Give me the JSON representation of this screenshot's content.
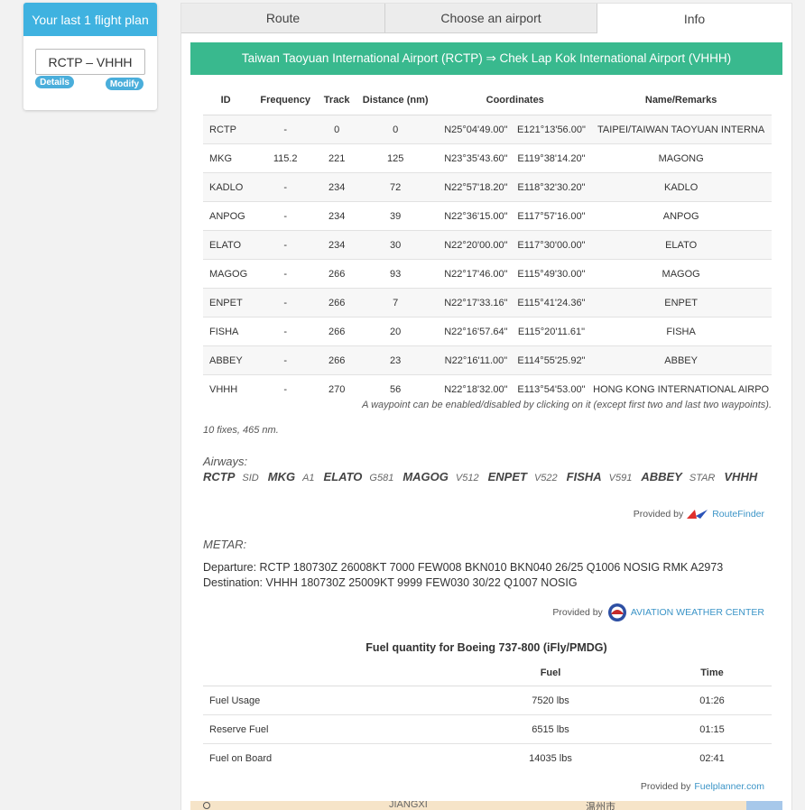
{
  "sidebar": {
    "header": "Your last 1 flight plan",
    "plan": "RCTP – VHHH",
    "details_label": "Details",
    "modify_label": "Modify"
  },
  "tabs": [
    "Route",
    "Choose an airport",
    "Info"
  ],
  "banner": "Taiwan Taoyuan International Airport (RCTP) ⇒ Chek Lap Kok International Airport (VHHH)",
  "waypoints": {
    "headers": [
      "ID",
      "Frequency",
      "Track",
      "Distance (nm)",
      "Coordinates",
      "Name/Remarks"
    ],
    "rows": [
      {
        "id": "RCTP",
        "freq": "-",
        "track": "0",
        "dist": "0",
        "lat": "N25°04'49.00\"",
        "lon": "E121°13'56.00\"",
        "name": "TAIPEI/TAIWAN TAOYUAN INTERNA"
      },
      {
        "id": "MKG",
        "freq": "115.2",
        "track": "221",
        "dist": "125",
        "lat": "N23°35'43.60\"",
        "lon": "E119°38'14.20\"",
        "name": "MAGONG"
      },
      {
        "id": "KADLO",
        "freq": "-",
        "track": "234",
        "dist": "72",
        "lat": "N22°57'18.20\"",
        "lon": "E118°32'30.20\"",
        "name": "KADLO"
      },
      {
        "id": "ANPOG",
        "freq": "-",
        "track": "234",
        "dist": "39",
        "lat": "N22°36'15.00\"",
        "lon": "E117°57'16.00\"",
        "name": "ANPOG"
      },
      {
        "id": "ELATO",
        "freq": "-",
        "track": "234",
        "dist": "30",
        "lat": "N22°20'00.00\"",
        "lon": "E117°30'00.00\"",
        "name": "ELATO"
      },
      {
        "id": "MAGOG",
        "freq": "-",
        "track": "266",
        "dist": "93",
        "lat": "N22°17'46.00\"",
        "lon": "E115°49'30.00\"",
        "name": "MAGOG"
      },
      {
        "id": "ENPET",
        "freq": "-",
        "track": "266",
        "dist": "7",
        "lat": "N22°17'33.16\"",
        "lon": "E115°41'24.36\"",
        "name": "ENPET"
      },
      {
        "id": "FISHA",
        "freq": "-",
        "track": "266",
        "dist": "20",
        "lat": "N22°16'57.64\"",
        "lon": "E115°20'11.61\"",
        "name": "FISHA"
      },
      {
        "id": "ABBEY",
        "freq": "-",
        "track": "266",
        "dist": "23",
        "lat": "N22°16'11.00\"",
        "lon": "E114°55'25.92\"",
        "name": "ABBEY"
      },
      {
        "id": "VHHH",
        "freq": "-",
        "track": "270",
        "dist": "56",
        "lat": "N22°18'32.00\"",
        "lon": "E113°54'53.00\"",
        "name": "HONG KONG INTERNATIONAL AIRPO"
      }
    ],
    "note": "A waypoint can be enabled/disabled by clicking on it (except first two and last two waypoints).",
    "summary": "10 fixes, 465 nm."
  },
  "airways": {
    "title": "Airways:",
    "items": [
      {
        "fix": "RCTP",
        "awy": "SID"
      },
      {
        "fix": "MKG",
        "awy": "A1"
      },
      {
        "fix": "ELATO",
        "awy": "G581"
      },
      {
        "fix": "MAGOG",
        "awy": "V512"
      },
      {
        "fix": "ENPET",
        "awy": "V522"
      },
      {
        "fix": "FISHA",
        "awy": "V591"
      },
      {
        "fix": "ABBEY",
        "awy": "STAR"
      },
      {
        "fix": "VHHH",
        "awy": ""
      }
    ],
    "provided_by": "Provided by",
    "provider": "RouteFinder"
  },
  "metar": {
    "title": "METAR:",
    "departure": "Departure: RCTP 180730Z 26008KT 7000 FEW008 BKN010 BKN040 26/25 Q1006 NOSIG RMK A2973",
    "destination": "Destination: VHHH 180730Z 25009KT 9999 FEW030 30/22 Q1007 NOSIG",
    "provided_by": "Provided by",
    "provider": "AVIATION WEATHER CENTER"
  },
  "fuel": {
    "title": "Fuel quantity for Boeing 737-800 (iFly/PMDG)",
    "headers": [
      "",
      "Fuel",
      "Time"
    ],
    "rows": [
      {
        "label": "Fuel Usage",
        "fuel": "7520 lbs",
        "time": "01:26"
      },
      {
        "label": "Reserve Fuel",
        "fuel": "6515 lbs",
        "time": "01:15"
      },
      {
        "label": "Fuel on Board",
        "fuel": "14035 lbs",
        "time": "02:41"
      }
    ],
    "provided_by": "Provided by",
    "provider": "Fuelplanner.com"
  },
  "map": {
    "label_left": "JIANGXI",
    "label_right": "温州市"
  },
  "colors": {
    "sidebar_header": "#3fb2e0",
    "banner": "#39b98e",
    "link": "#3b94c7"
  }
}
